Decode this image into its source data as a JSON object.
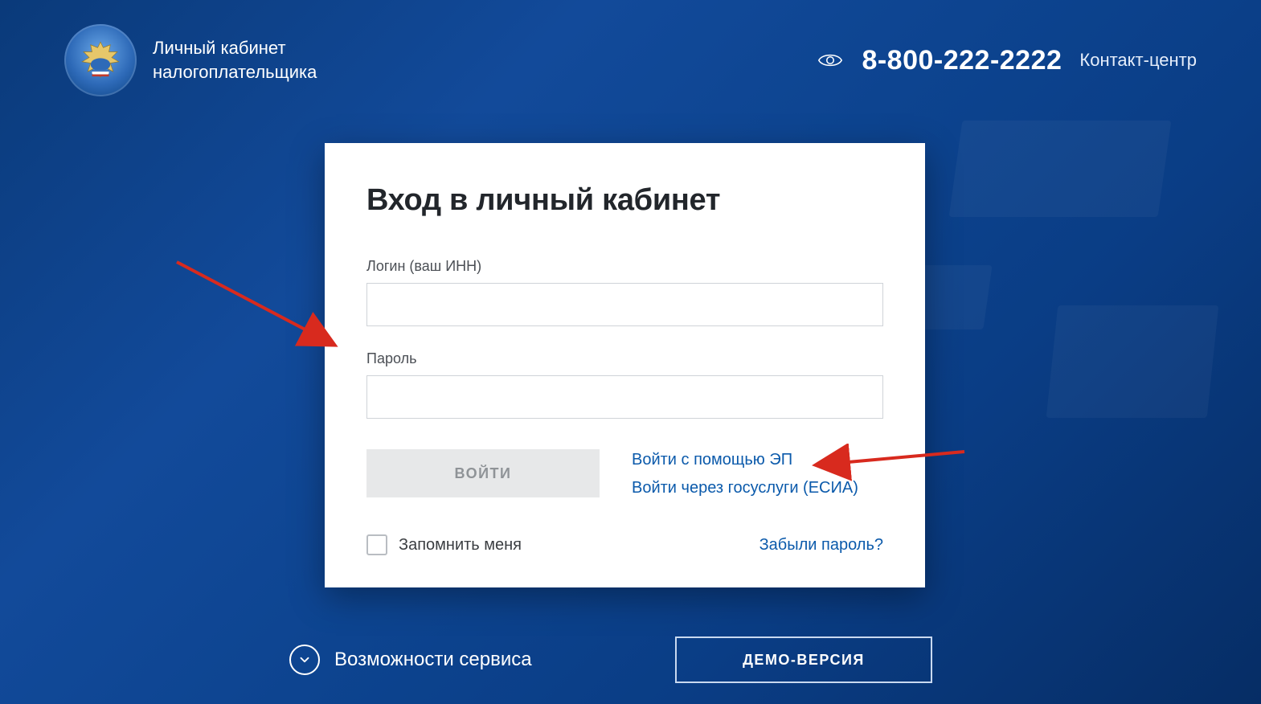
{
  "header": {
    "brand_line1": "Личный кабинет",
    "brand_line2": "налогоплательщика",
    "phone": "8-800-222-2222",
    "contact_label": "Контакт-центр"
  },
  "login": {
    "title": "Вход в личный кабинет",
    "login_label": "Логин (ваш ИНН)",
    "password_label": "Пароль",
    "submit_label": "ВОЙТИ",
    "link_ep": "Войти с помощью ЭП",
    "link_esia": "Войти через госуслуги (ЕСИА)",
    "remember_label": "Запомнить меня",
    "forgot_label": "Забыли пароль?"
  },
  "footer": {
    "capabilities_label": "Возможности сервиса",
    "demo_label": "ДЕМО-ВЕРСИЯ"
  }
}
